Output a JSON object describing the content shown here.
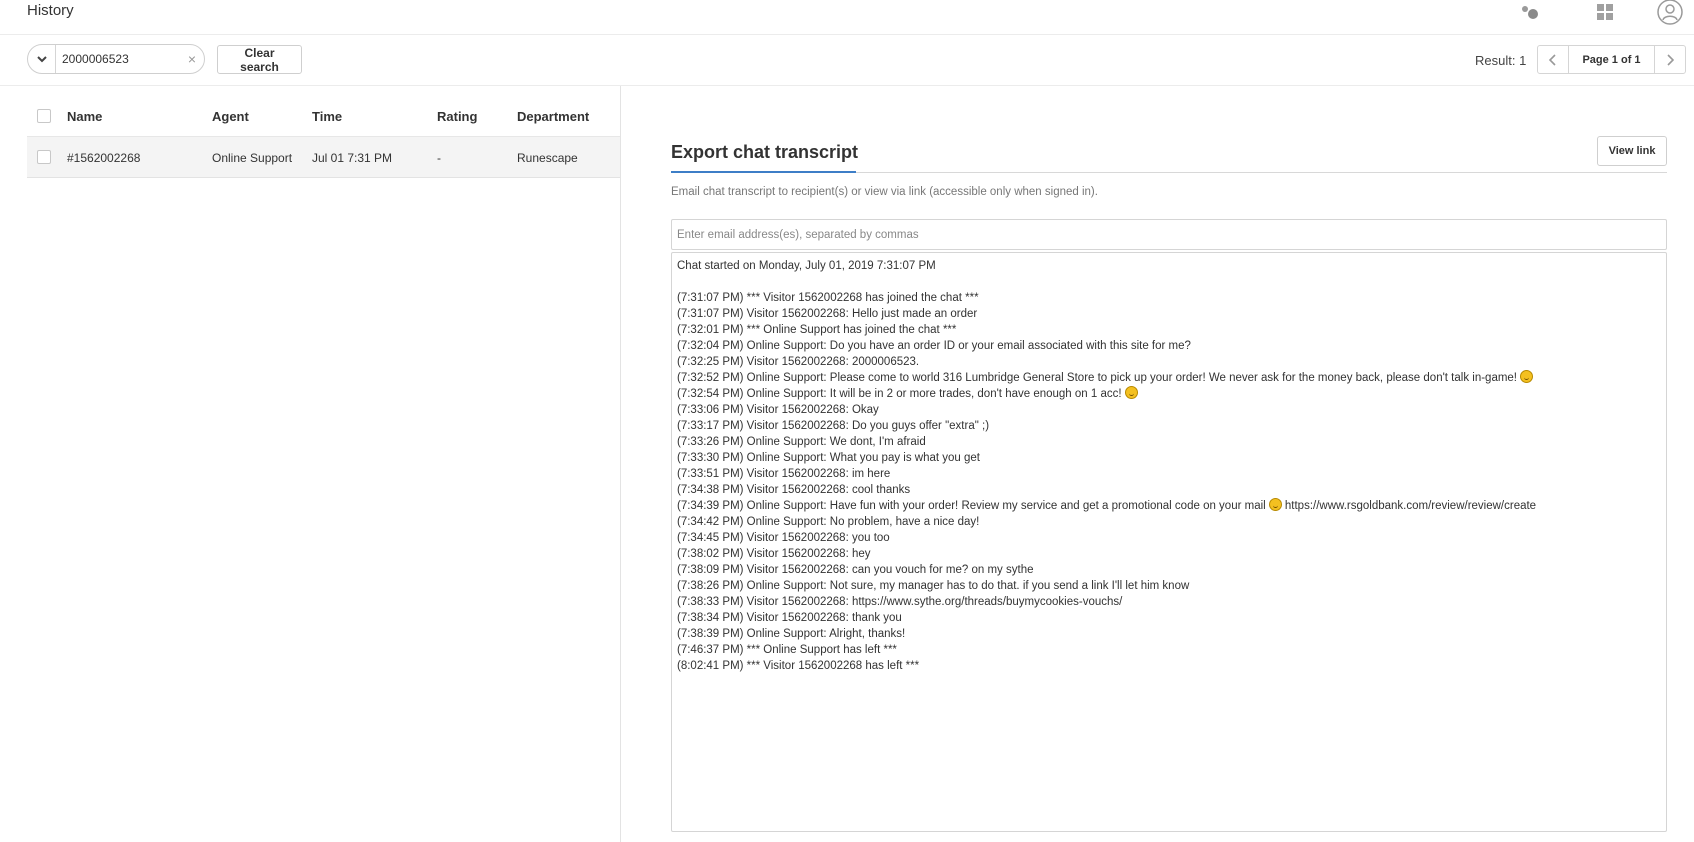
{
  "header": {
    "title": "History",
    "icons": [
      "status-icon",
      "apps-grid-icon",
      "user-avatar-icon"
    ]
  },
  "toolbar": {
    "search_value": "2000006523",
    "clear_search_label": "Clear search",
    "result_text": "Result: 1",
    "page_text": "Page 1 of 1"
  },
  "table": {
    "columns": [
      "Name",
      "Agent",
      "Time",
      "Rating",
      "Department"
    ],
    "rows": [
      {
        "name": "#1562002268",
        "agent": "Online Support",
        "time": "Jul 01 7:31 PM",
        "rating": "-",
        "department": "Runescape"
      }
    ]
  },
  "export": {
    "title": "Export chat transcript",
    "view_link_label": "View link",
    "description": "Email chat transcript to recipient(s) or view via link (accessible only when signed in).",
    "email_placeholder": "Enter email address(es), separated by commas",
    "transcript": [
      "Chat started on Monday, July 01, 2019 7:31:07 PM",
      "",
      "(7:31:07 PM) *** Visitor 1562002268 has joined the chat ***",
      "(7:31:07 PM) Visitor 1562002268: Hello just made an order",
      "(7:32:01 PM) *** Online Support has joined the chat ***",
      "(7:32:04 PM) Online Support: Do you have an order ID or your email associated with this site for me?",
      "(7:32:25 PM) Visitor 1562002268: 2000006523.",
      "(7:32:52 PM) Online Support: Please come to world 316 Lumbridge General Store to pick up your order!  We never ask for the money back, please don't talk in-game!",
      "(7:32:54 PM) Online Support: It will be in 2 or more trades, don't have enough on 1 acc!",
      "(7:33:06 PM) Visitor 1562002268: Okay",
      "(7:33:17 PM) Visitor 1562002268: Do you guys offer \"extra\" ;)",
      "(7:33:26 PM) Online Support: We dont, I'm afraid",
      "(7:33:30 PM) Online Support: What you pay is what you get",
      "(7:33:51 PM) Visitor 1562002268: im here",
      "(7:34:38 PM) Visitor 1562002268: cool thanks",
      "(7:34:39 PM) Online Support: Have fun with your order! Review my service and get a promotional code on your mail",
      "(7:34:42 PM) Online Support: No problem, have a nice day!",
      "(7:34:45 PM) Visitor 1562002268: you too",
      "(7:38:02 PM) Visitor 1562002268: hey",
      "(7:38:09 PM) Visitor 1562002268: can you vouch for me? on my sythe",
      "(7:38:26 PM) Online Support: Not sure, my manager has to do that. if you send a link I'll let him know",
      "(7:38:33 PM) Visitor 1562002268: https://www.sythe.org/threads/buymycookies-vouchs/",
      "(7:38:34 PM) Visitor 1562002268: thank you",
      "(7:38:39 PM) Online Support: Alright, thanks!",
      "(7:46:37 PM) *** Online Support has left ***",
      "(8:02:41 PM) *** Visitor 1562002268 has left ***"
    ],
    "transcript_line_16_link": "https://www.rsgoldbank.com/review/review/create",
    "emoji_lines": [
      7,
      8,
      15
    ]
  }
}
